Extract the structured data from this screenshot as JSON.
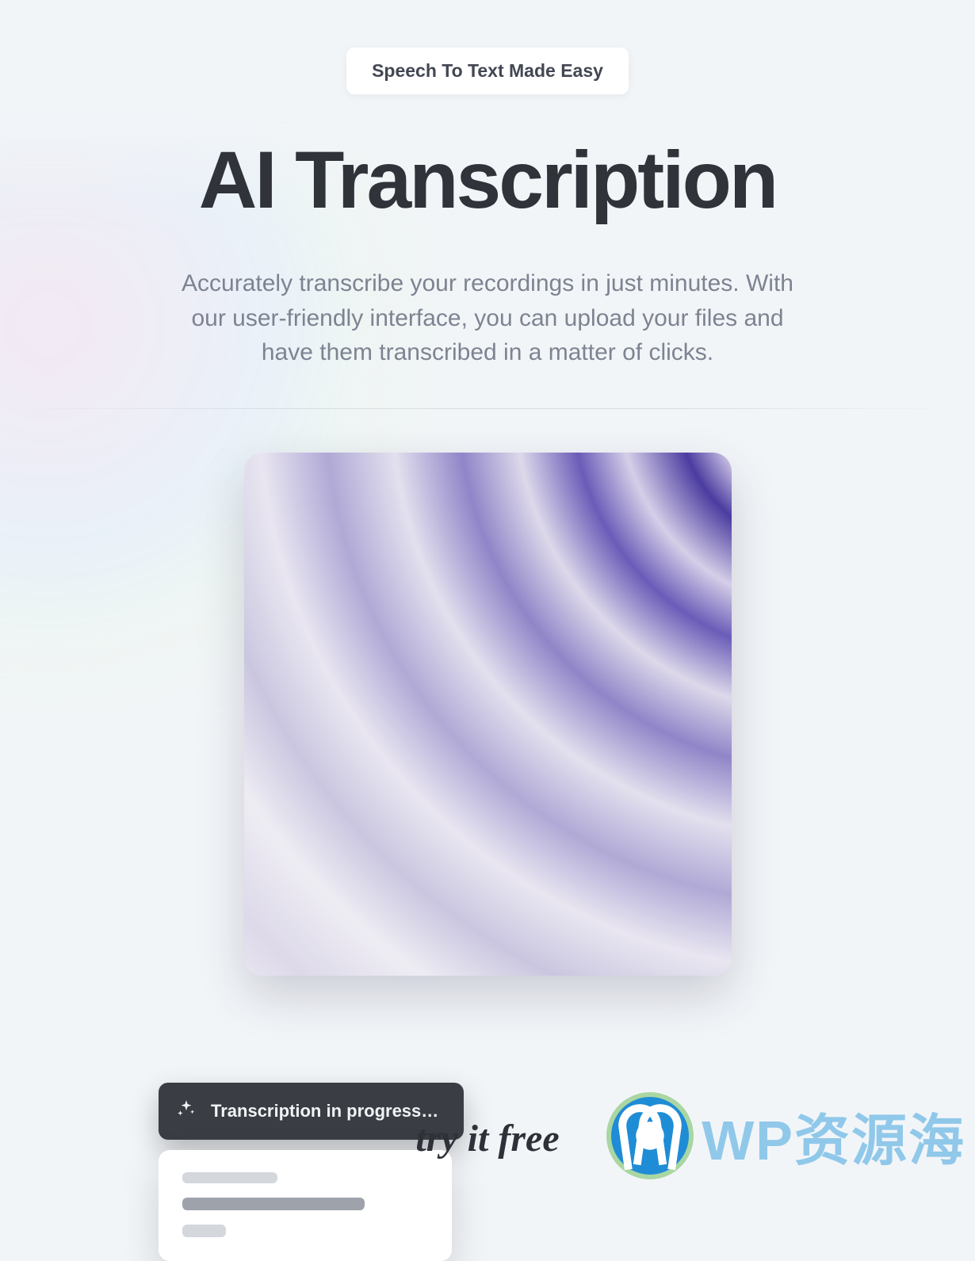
{
  "hero": {
    "badge": "Speech To Text Made Easy",
    "title": "AI Transcription",
    "subtitle": "Accurately transcribe your recordings in just minutes. With our user-friendly interface, you can upload your files and have them transcribed in a matter of clicks."
  },
  "status": {
    "label": "Transcription in progress…",
    "icon": "sparkle-icon"
  },
  "cta": {
    "text": "try it free"
  },
  "watermark": {
    "text": "WP资源海"
  }
}
